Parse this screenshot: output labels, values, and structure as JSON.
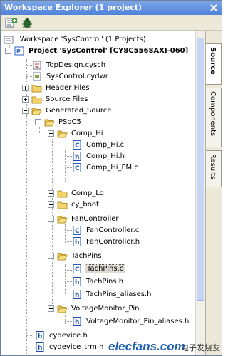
{
  "window": {
    "title": "Workspace Explorer (1 project)"
  },
  "workspace_label": "'Workspace 'SysControl' (1 Projects)",
  "project_label": "Project 'SysControl' [CY8C5568AXI-060]",
  "tree": {
    "topdesign": "TopDesign.cysch",
    "cydwr": "SysControl.cydwr",
    "header_files": "Header Files",
    "source_files": "Source Files",
    "generated_source": "Generated_Source",
    "psoc5": "PSoC5",
    "comp_hi": "Comp_Hi",
    "comp_hi_c": "Comp_Hi.c",
    "comp_hi_h": "Comp_Hi.h",
    "comp_hi_pm_c": "Comp_Hi_PM.c",
    "comp_lo": "Comp_Lo",
    "cy_boot": "cy_boot",
    "fancontroller": "FanController",
    "fancontroller_c": "FanController.c",
    "fancontroller_h": "FanController.h",
    "tachpins": "TachPins",
    "tachpins_c": "TachPins.c",
    "tachpins_h": "TachPins.h",
    "tachpins_aliases_h": "TachPins_aliases.h",
    "voltagemonitor_pin": "VoltageMonitor_Pin",
    "voltagemonitor_aliases_h": "VoltageMonitor_Pin_aliases.h",
    "cydevice_h": "cydevice.h",
    "cydevice_trm_h": "cydevice_trm.h"
  },
  "side_tabs": {
    "source": "Source",
    "components": "Components",
    "results": "Results"
  },
  "watermark": {
    "logo": "elecfans.com",
    "cn": "电子发烧友"
  },
  "colors": {
    "titlebar": "#4f82d9",
    "folder": "#f2d36b",
    "file_c": "#2a5fc4",
    "file_h": "#1b4aa8"
  }
}
